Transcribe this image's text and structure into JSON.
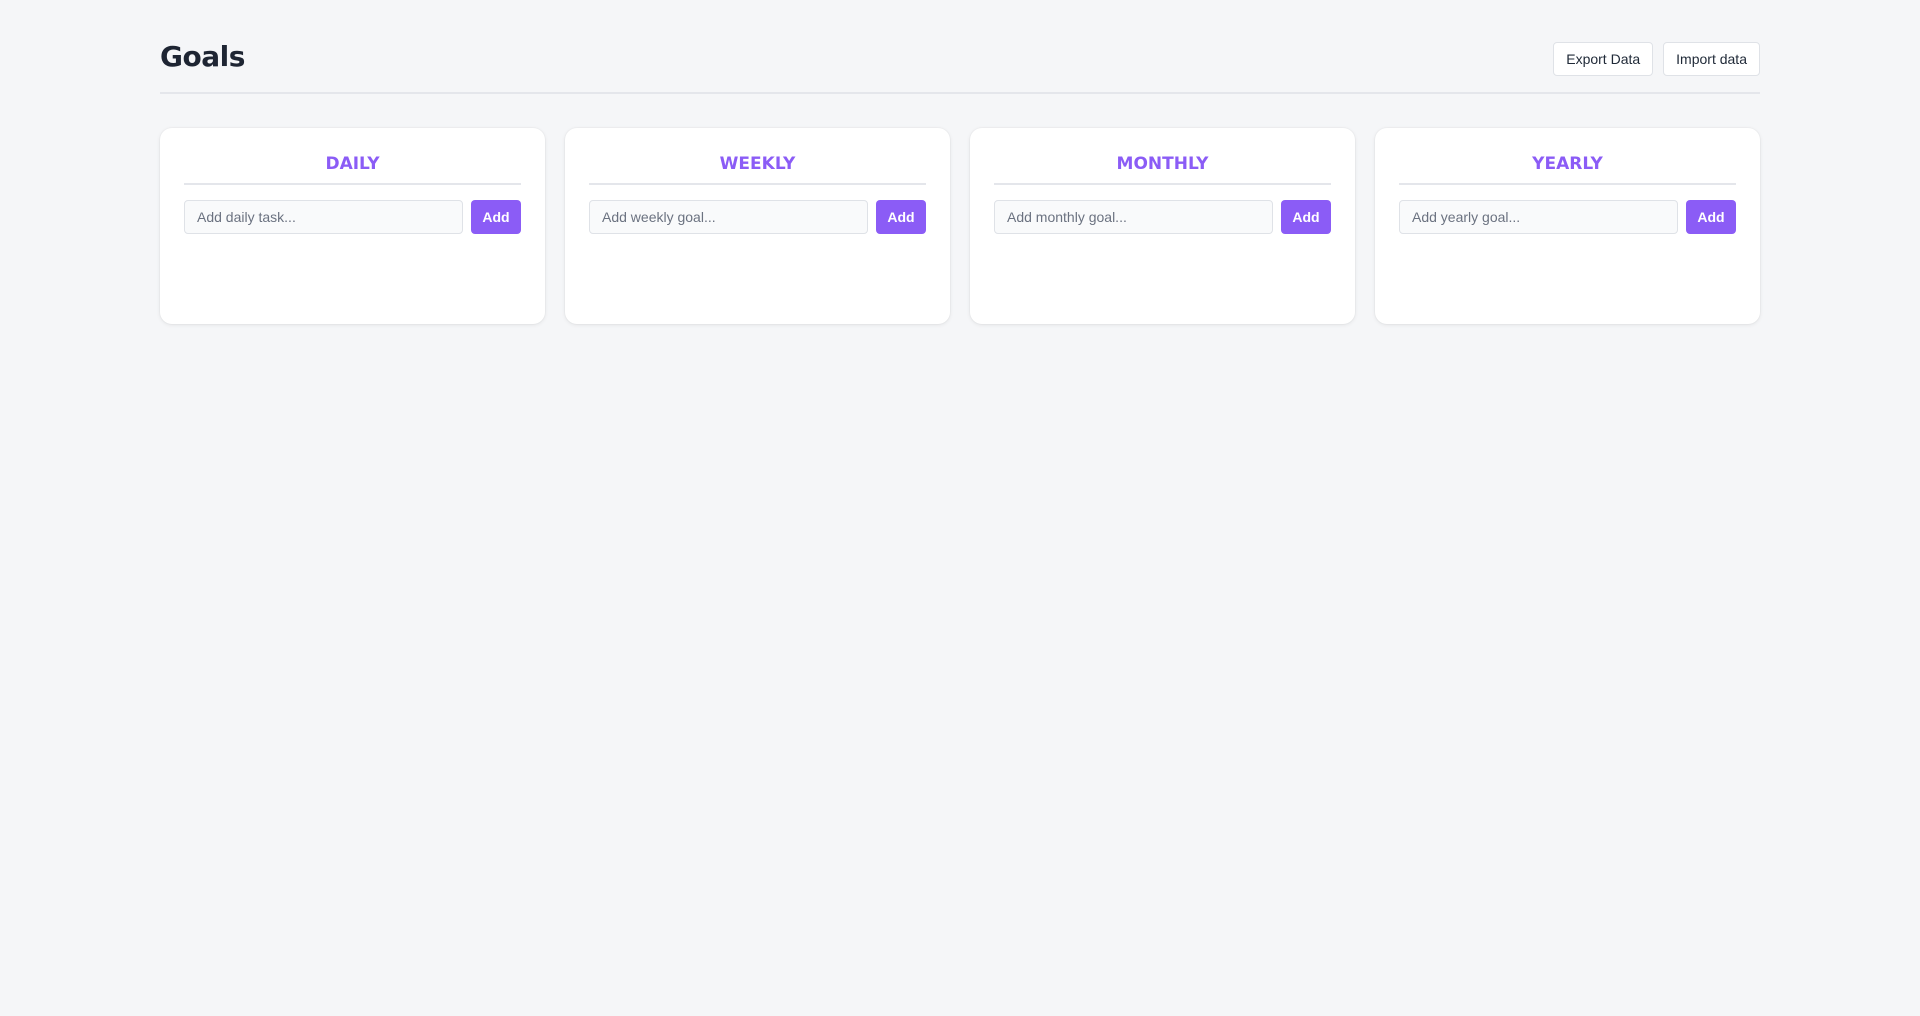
{
  "header": {
    "title": "Goals",
    "export_label": "Export Data",
    "import_label": "Import data"
  },
  "columns": [
    {
      "title": "DAILY",
      "placeholder": "Add daily task...",
      "add_label": "Add",
      "items": []
    },
    {
      "title": "WEEKLY",
      "placeholder": "Add weekly goal...",
      "add_label": "Add",
      "items": []
    },
    {
      "title": "MONTHLY",
      "placeholder": "Add monthly goal...",
      "add_label": "Add",
      "items": []
    },
    {
      "title": "YEARLY",
      "placeholder": "Add yearly goal...",
      "add_label": "Add",
      "items": []
    }
  ],
  "colors": {
    "accent": "#8b5cf6",
    "background": "#f5f6f8",
    "card": "#ffffff",
    "title_text": "#1e2533"
  }
}
